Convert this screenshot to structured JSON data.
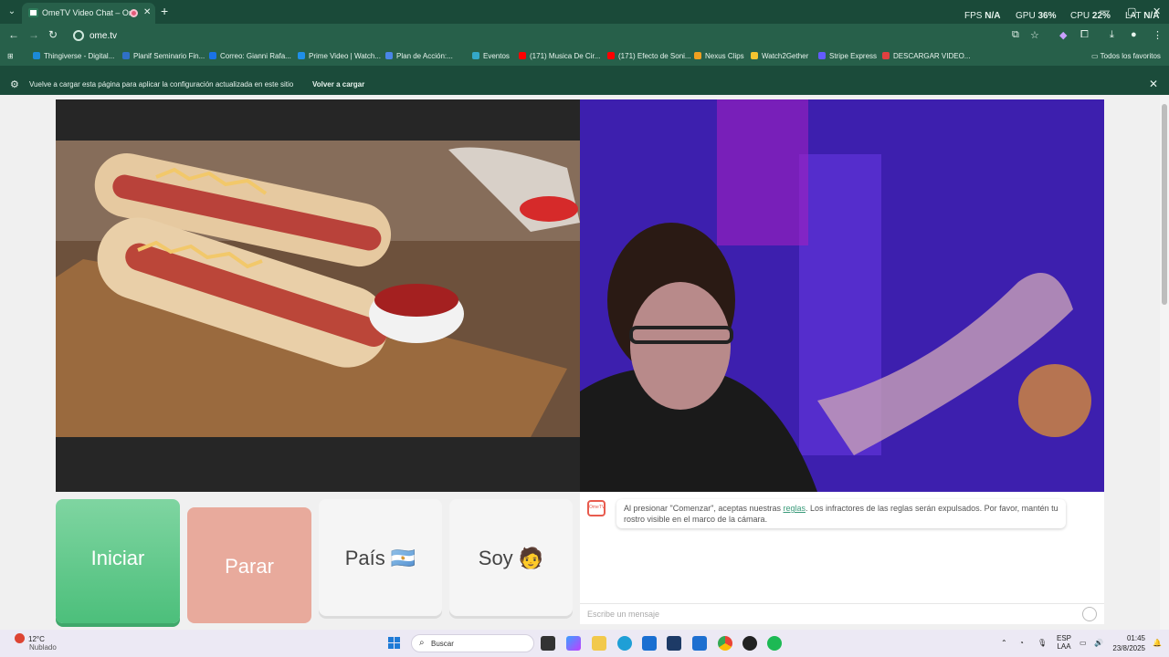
{
  "browser": {
    "tab_title": "OmeTV Video Chat – Ome",
    "tab_close": "✕",
    "new_tab": "+",
    "menu_chevron": "⌄",
    "perf": {
      "fps_label": "FPS",
      "fps_value": "N/A",
      "gpu_label": "GPU",
      "gpu_value": "36",
      "cpu_label": "CPU",
      "cpu_value": "22",
      "lat_label": "LAT",
      "lat_value": "N/A"
    },
    "window_min": "—",
    "window_max": "▢",
    "window_close": "✕",
    "url": "ome.tv",
    "bookmarks": [
      {
        "label": "Thingiverse - Digital...",
        "color": "#1b8ad8"
      },
      {
        "label": "Planif Seminario Fin...",
        "color": "#2f70c6"
      },
      {
        "label": "Correo: Gianni Rafa...",
        "color": "#1a73e8"
      },
      {
        "label": "Prime Video | Watch...",
        "color": "#1f8fe8"
      },
      {
        "label": "Plan de Acción:...",
        "color": "#4a86e8"
      },
      {
        "label": "Eventos",
        "color": "#34a8c8"
      },
      {
        "label": "(171) Musica De Cir...",
        "color": "#ff0000"
      },
      {
        "label": "(171) Efecto de Soni...",
        "color": "#ff0000"
      },
      {
        "label": "Nexus Clips",
        "color": "#f0a020"
      },
      {
        "label": "Watch2Gether",
        "color": "#f4c430"
      },
      {
        "label": "Stripe Express",
        "color": "#635bff"
      },
      {
        "label": "DESCARGAR VIDEO...",
        "color": "#e04040"
      }
    ],
    "all_favorites": "Todos los favoritos",
    "infobar_message": "Vuelve a cargar esta página para aplicar la configuración actualizada en este sitio",
    "infobar_button": "Volver a cargar"
  },
  "page": {
    "start_button": "Iniciar",
    "stop_button": "Parar",
    "country_button": "País",
    "country_flag": "🇦🇷",
    "gender_button": "Soy",
    "gender_emoji": "🧑",
    "chat_logo": "OmeTV",
    "chat_notice_before": "Al presionar \"Comenzar\", aceptas nuestras ",
    "chat_notice_link": "reglas",
    "chat_notice_after": ". Los infractores de las reglas serán expulsados. Por favor, mantén tu rostro visible en el marco de la cámara.",
    "chat_placeholder": "Escribe un mensaje"
  },
  "taskbar": {
    "temperature": "12°C",
    "condition": "Nublado",
    "search_placeholder": "Buscar",
    "language_top": "ESP",
    "language_bottom": "LAA",
    "time": "01:45",
    "date": "23/8/2025"
  }
}
